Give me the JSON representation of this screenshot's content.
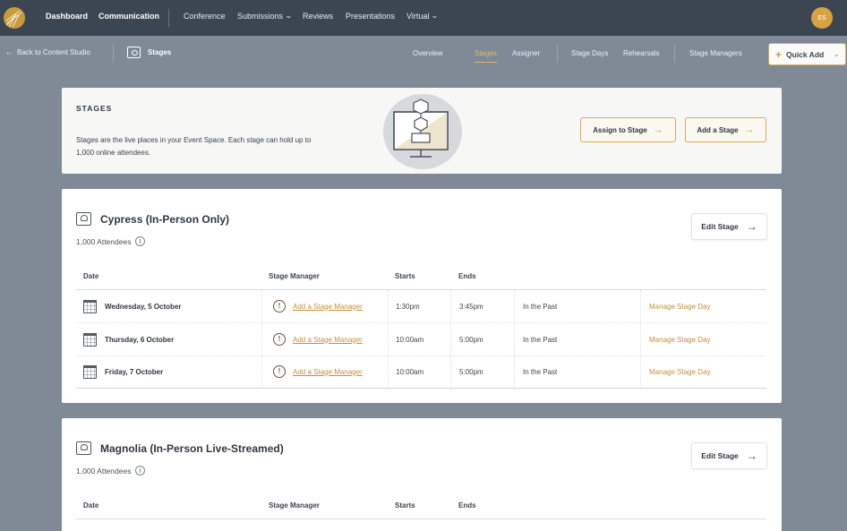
{
  "topnav": {
    "primary": [
      "Dashboard",
      "Communication"
    ],
    "items": [
      {
        "label": "Conference"
      },
      {
        "label": "Submissions",
        "dropdown": true
      },
      {
        "label": "Reviews"
      },
      {
        "label": "Presentations"
      },
      {
        "label": "Virtual",
        "dropdown": true
      }
    ],
    "avatar_initials": "ES"
  },
  "subnav": {
    "back_label": "Back to Content Studio",
    "breadcrumb": "Stages",
    "tabs": [
      "Overview",
      "Stages",
      "Assigner",
      "Stage Days",
      "Rehearsals",
      "Stage Managers"
    ],
    "active_tab": "Stages",
    "quick_add": "Quick Add"
  },
  "intro": {
    "heading": "STAGES",
    "description": "Stages are the live places in your Event Space. Each stage can hold up to 1,000 online attendees.",
    "assign_button": "Assign to Stage",
    "add_button": "Add a Stage"
  },
  "columns": [
    "Date",
    "Stage Manager",
    "Starts",
    "Ends"
  ],
  "stages": [
    {
      "name": "Cypress (In-Person Only)",
      "attendees": "1,000 Attendees",
      "edit_label": "Edit Stage",
      "days": [
        {
          "date": "Wednesday, 5 October",
          "manager": "Add a Stage Manager",
          "starts": "1:30pm",
          "ends": "3:45pm",
          "status": "In the Past",
          "action": "Manage Stage Day"
        },
        {
          "date": "Thursday, 6 October",
          "manager": "Add a Stage Manager",
          "starts": "10:00am",
          "ends": "5:00pm",
          "status": "In the Past",
          "action": "Manage Stage Day"
        },
        {
          "date": "Friday, 7 October",
          "manager": "Add a Stage Manager",
          "starts": "10:00am",
          "ends": "5:00pm",
          "status": "In the Past",
          "action": "Manage Stage Day"
        }
      ]
    },
    {
      "name": "Magnolia (In-Person Live-Streamed)",
      "attendees": "1,000 Attendees",
      "edit_label": "Edit Stage",
      "days": []
    }
  ],
  "colors": {
    "topbar": "#3c4652",
    "page_bg": "#7f8a96",
    "accent": "#c4913a"
  }
}
